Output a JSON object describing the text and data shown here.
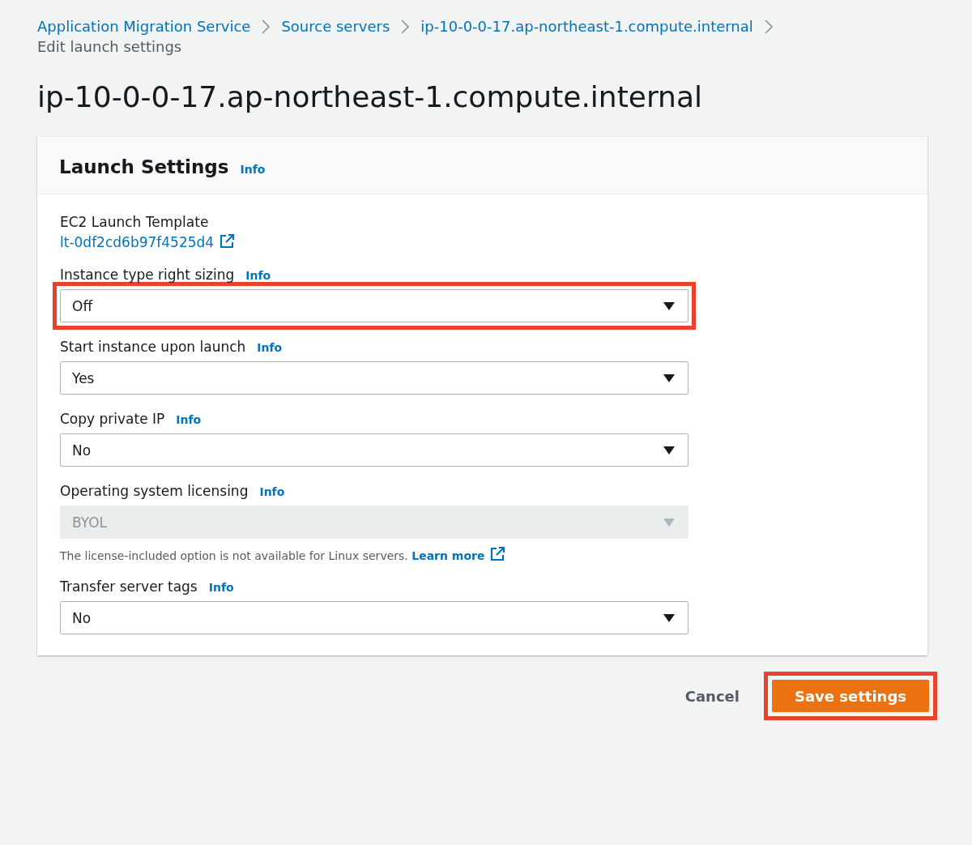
{
  "breadcrumbs": [
    {
      "label": "Application Migration Service"
    },
    {
      "label": "Source servers"
    },
    {
      "label": "ip-10-0-0-17.ap-northeast-1.compute.internal"
    },
    {
      "label": "Edit launch settings",
      "current": true
    }
  ],
  "page_title": "ip-10-0-0-17.ap-northeast-1.compute.internal",
  "panel": {
    "title": "Launch Settings",
    "info": "Info",
    "fields": [
      {
        "kind": "link",
        "label": "EC2 Launch Template",
        "value": "lt-0df2cd6b97f4525d4"
      },
      {
        "kind": "select",
        "label": "Instance type right sizing",
        "info": "Info",
        "value": "Off",
        "disabled": false,
        "highlighted": true
      },
      {
        "kind": "select",
        "label": "Start instance upon launch",
        "info": "Info",
        "value": "Yes",
        "disabled": false,
        "highlighted": false
      },
      {
        "kind": "select",
        "label": "Copy private IP",
        "info": "Info",
        "value": "No",
        "disabled": false,
        "highlighted": false
      },
      {
        "kind": "select",
        "label": "Operating system licensing",
        "info": "Info",
        "value": "BYOL",
        "disabled": true,
        "highlighted": false,
        "hint": "The license-included option is not available for Linux servers.",
        "hint_link": "Learn more"
      },
      {
        "kind": "select",
        "label": "Transfer server tags",
        "info": "Info",
        "value": "No",
        "disabled": false,
        "highlighted": false
      }
    ]
  },
  "actions": [
    {
      "kind": "link",
      "label": "Cancel",
      "highlighted": false
    },
    {
      "kind": "primary",
      "label": "Save settings",
      "highlighted": true
    }
  ]
}
